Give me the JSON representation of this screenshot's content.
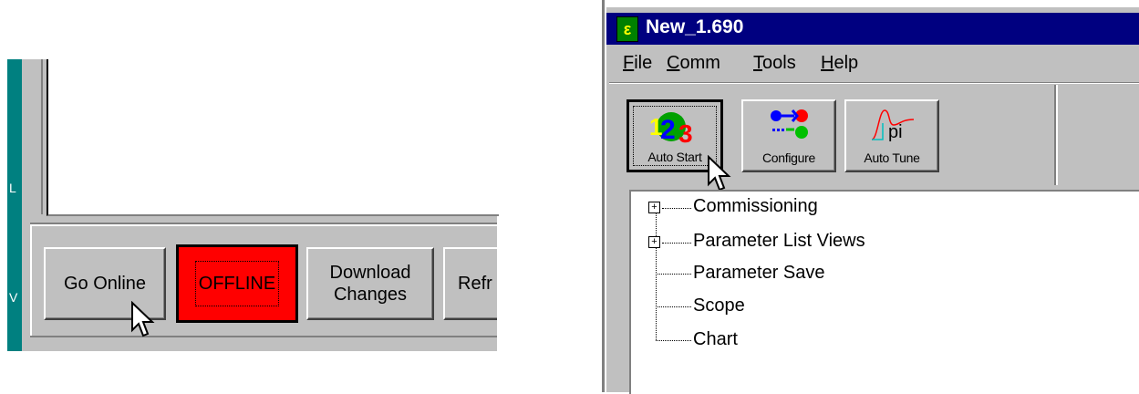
{
  "left_panel": {
    "strip_letters": [
      "L",
      "V"
    ],
    "buttons": {
      "go_online": "Go Online",
      "offline": "OFFLINE",
      "download_line1": "Download",
      "download_line2": "Changes",
      "refresh_partial": "Refr"
    }
  },
  "window": {
    "title": "New_1.690",
    "icon_glyph": "ε",
    "menu": [
      "File",
      "Comm",
      "Tools",
      "Help"
    ],
    "menu_underlines": [
      "F",
      "C",
      "T",
      "H"
    ],
    "toolbar": [
      {
        "label": "Auto Start",
        "icon": "auto-start-123-icon"
      },
      {
        "label": "Configure",
        "icon": "configure-icon"
      },
      {
        "label": "Auto Tune",
        "icon": "auto-tune-pi-icon"
      }
    ],
    "tree": [
      {
        "label": "Commissioning",
        "expandable": true
      },
      {
        "label": "Parameter List Views",
        "expandable": true
      },
      {
        "label": "Parameter Save",
        "expandable": false
      },
      {
        "label": "Scope",
        "expandable": false
      },
      {
        "label": "Chart",
        "expandable": false
      }
    ]
  },
  "colors": {
    "title_bar": "#000080",
    "offline_button": "#ff0000",
    "face": "#c0c0c0",
    "teal_strip": "#008080"
  }
}
